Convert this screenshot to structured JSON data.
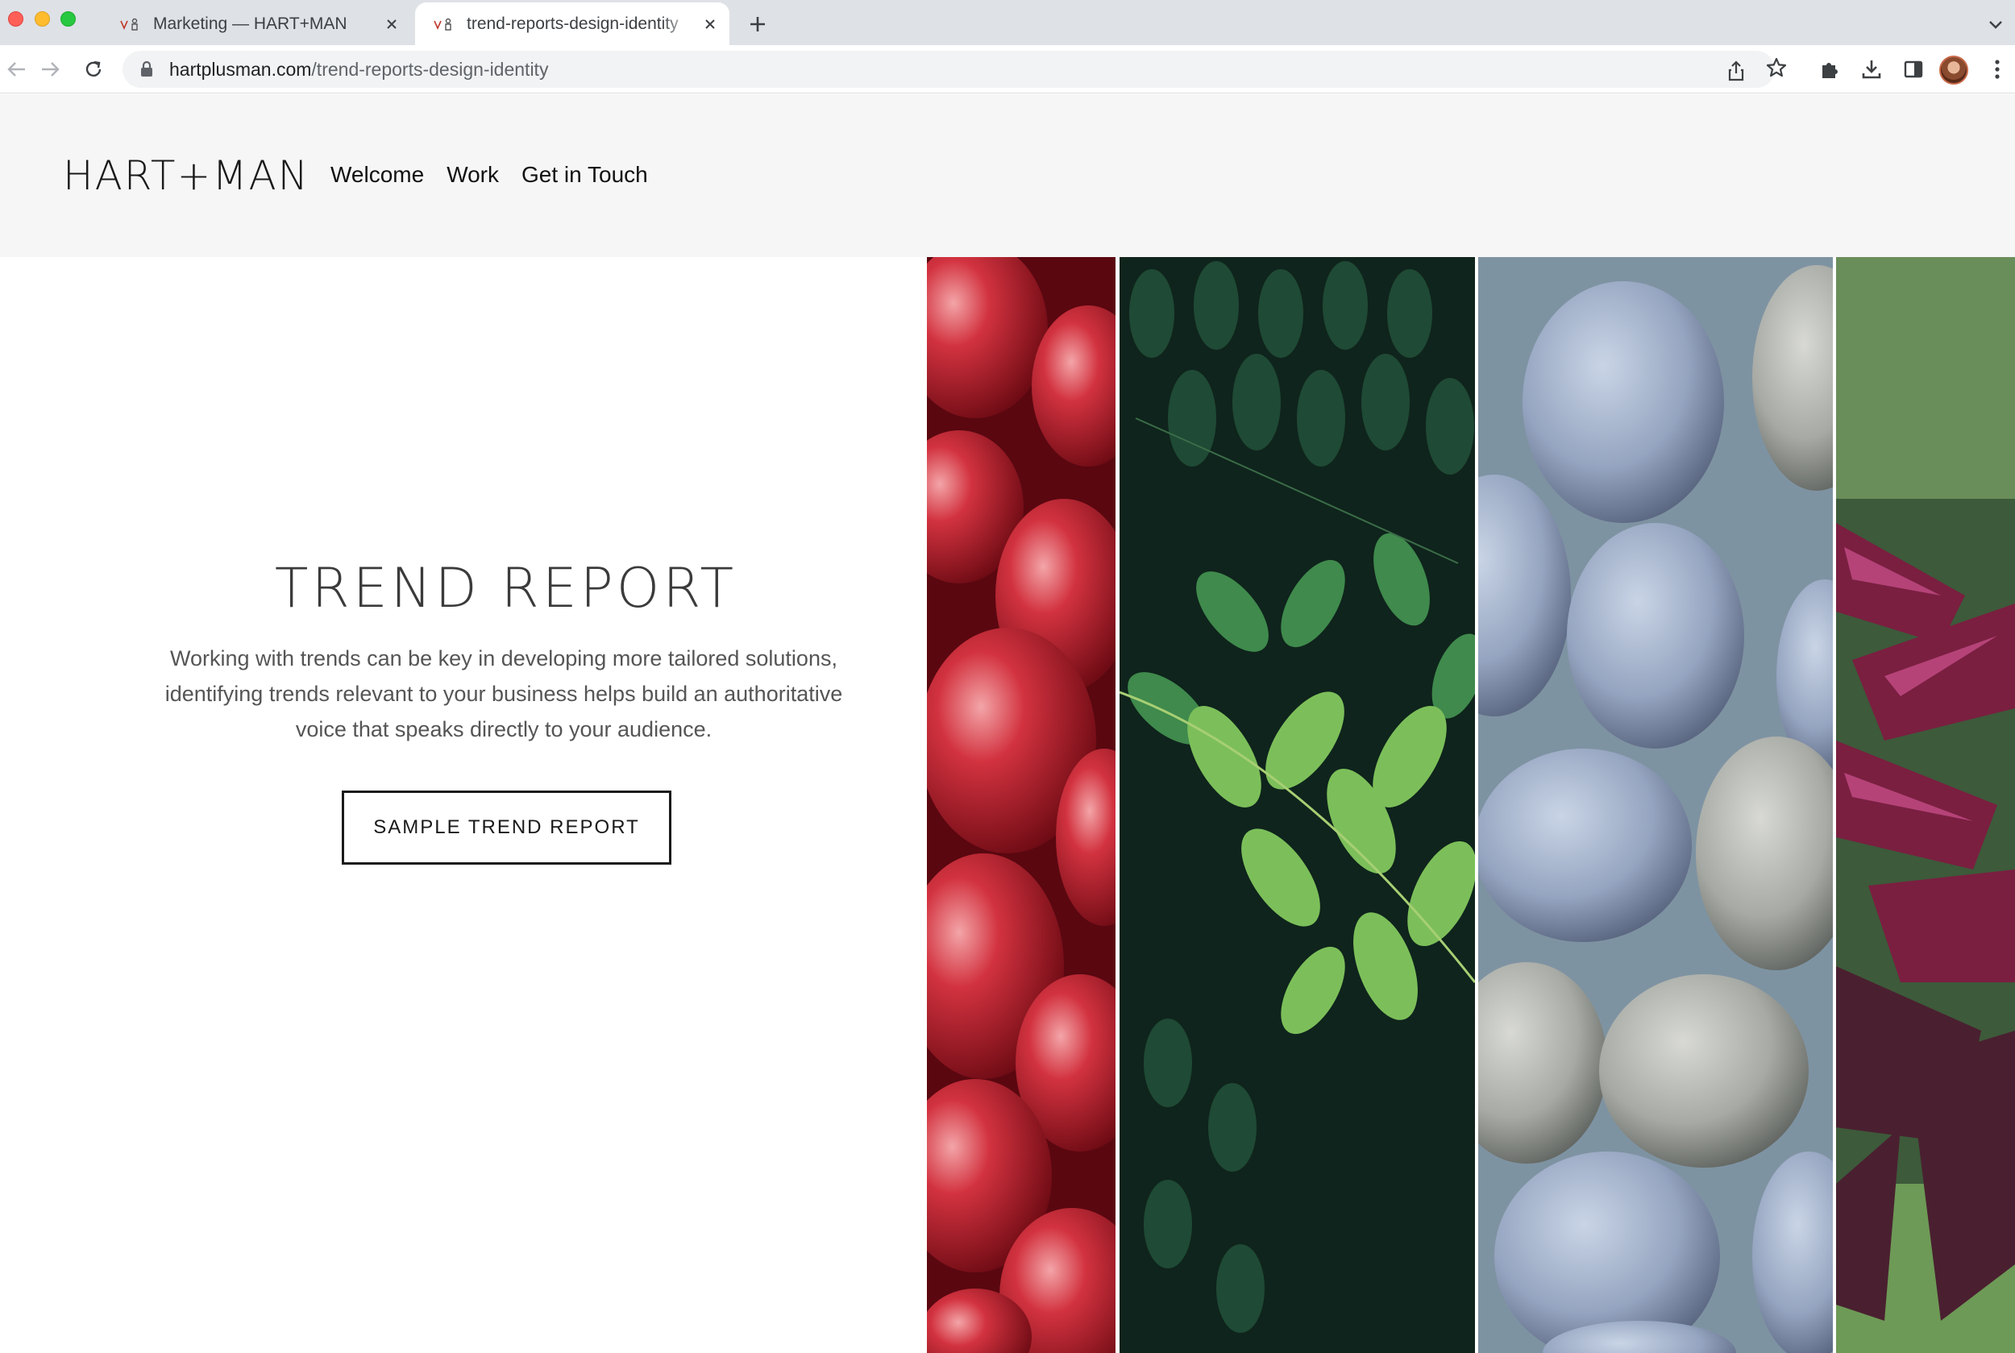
{
  "browser": {
    "tabs": [
      {
        "title": "Marketing — HART+MAN",
        "active": false
      },
      {
        "title": "trend-reports-design-identity",
        "active": true
      }
    ],
    "url_domain": "hartplusman.com",
    "url_path": "/trend-reports-design-identity"
  },
  "site": {
    "logo": "HART+MAN",
    "nav": [
      "Welcome",
      "Work",
      "Get in Touch"
    ]
  },
  "hero": {
    "title": "TREND REPORT",
    "text": "Working with trends can be key in developing more tailored solutions, identifying trends relevant to your business helps build an authoritative voice that speaks directly to your audience.",
    "cta": "SAMPLE TREND REPORT"
  },
  "gallery": {
    "panels": [
      "pomegranate-seeds",
      "green-leaves",
      "speckled-blue-eggs",
      "dark-purple-flower"
    ]
  },
  "colors": {
    "header_bg": "#f6f6f6",
    "text_dark": "#1a1a1a",
    "tab_strip": "#dee1e6"
  }
}
